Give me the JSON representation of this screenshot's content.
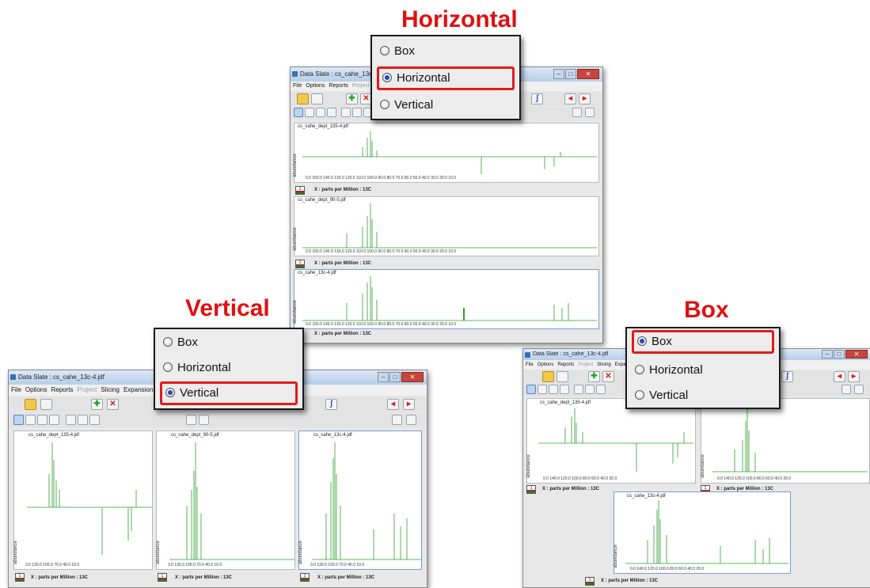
{
  "captions": {
    "horizontal": "Horizontal",
    "vertical": "Vertical",
    "box": "Box"
  },
  "popup": {
    "options": [
      "Box",
      "Horizontal",
      "Vertical"
    ]
  },
  "windows": {
    "top": {
      "title": "Data Slate : cs_cahe_13c-4.j"
    },
    "left": {
      "title": "Data Slate : cs_cahe_13c-4.jdf"
    },
    "right": {
      "title": "Data Slate : cs_cahe_13c-4.jdf"
    }
  },
  "menu": [
    "File",
    "Options",
    "Reports",
    "Project",
    "Slicing",
    "Expansion"
  ],
  "spectra": {
    "names": [
      "cs_cahe_dept_135-4.jdf",
      "cs_cahe_dept_90-5.jdf",
      "cs_cahe_13c-4.jdf"
    ],
    "ylabel": "abundance",
    "xlabel": "X : parts per Million : 13C",
    "xticks_full": "0.0  150.0  140.0  130.0  120.0  110.0  100.0  90.0  80.0  70.0  60.0  50.0  40.0  30.0  20.0  10.0",
    "xticks_vertical": "3.0  130.0  100.0  70.0  40.0  10.0",
    "xticks_box": "0.0   140.0   120.0   100.0   80.0   60.0   40.0   20.0"
  },
  "colors": {
    "spectrum": "#2e9e2e",
    "highlight": "#e21b1b",
    "caption": "#e01010"
  },
  "icons": [
    "folder-icon",
    "plus-icon",
    "close-icon",
    "cursor-icon",
    "hand-icon",
    "integral-icon",
    "arrow-left-icon",
    "arrow-right-icon"
  ]
}
